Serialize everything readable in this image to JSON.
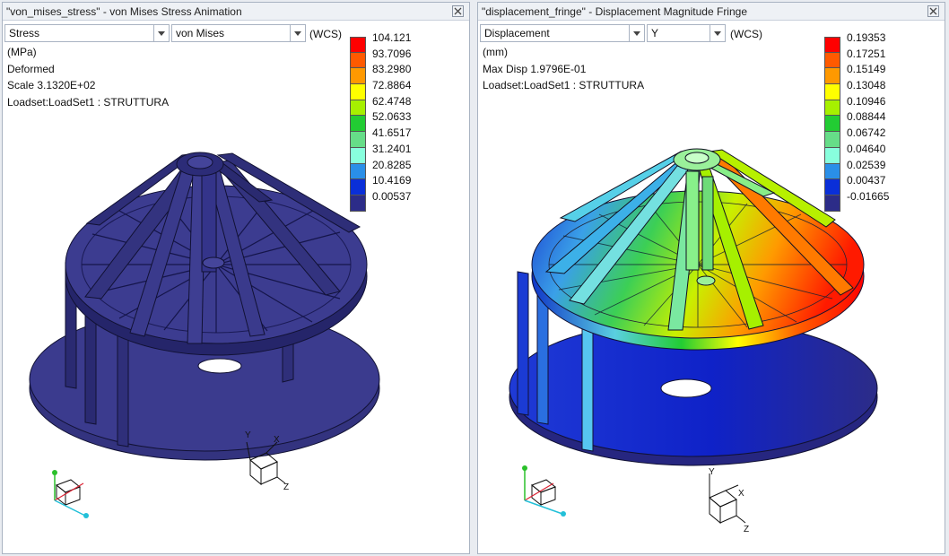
{
  "panes": [
    {
      "title": "\"von_mises_stress\" - von Mises Stress Animation",
      "quantity": "Stress",
      "component": "von Mises",
      "coord": "(WCS)",
      "info": [
        "(MPa)",
        "Deformed",
        "Scale  3.1320E+02",
        "Loadset:LoadSet1 :  STRUTTURA"
      ],
      "legend": {
        "labels": [
          "104.121",
          "93.7096",
          "83.2980",
          "72.8864",
          "62.4748",
          "52.0633",
          "41.6517",
          "31.2401",
          "20.8285",
          "10.4169",
          "0.00537"
        ],
        "colors": [
          "#ff0000",
          "#ff5a00",
          "#ff9900",
          "#ffff00",
          "#a6f000",
          "#22cc33",
          "#66dd88",
          "#88ffdd",
          "#2a8fe8",
          "#0a2fd8",
          "#2c2c88"
        ]
      }
    },
    {
      "title": "\"displacement_fringe\" - Displacement Magnitude Fringe",
      "quantity": "Displacement",
      "component": "Y",
      "coord": "(WCS)",
      "info": [
        "(mm)",
        "Max Disp  1.9796E-01",
        "Loadset:LoadSet1 :  STRUTTURA"
      ],
      "legend": {
        "labels": [
          "0.19353",
          "0.17251",
          "0.15149",
          "0.13048",
          "0.10946",
          "0.08844",
          "0.06742",
          "0.04640",
          "0.02539",
          "0.00437",
          "-0.01665"
        ],
        "colors": [
          "#ff0000",
          "#ff5a00",
          "#ff9900",
          "#ffff00",
          "#a6f000",
          "#22cc33",
          "#66dd88",
          "#88ffdd",
          "#2a8fe8",
          "#0a2fd8",
          "#2c2c88"
        ]
      }
    }
  ],
  "colors": {
    "model_stress": "#3a3a8a",
    "model_stress_dark": "#242468",
    "model_edge": "#111133"
  },
  "icons": [
    "close-icon",
    "dropdown-arrow-icon",
    "coordinate-triad-icon",
    "view-cube-icon"
  ],
  "triad_labels": {
    "y": "Y",
    "x": "X",
    "z": "Z"
  }
}
